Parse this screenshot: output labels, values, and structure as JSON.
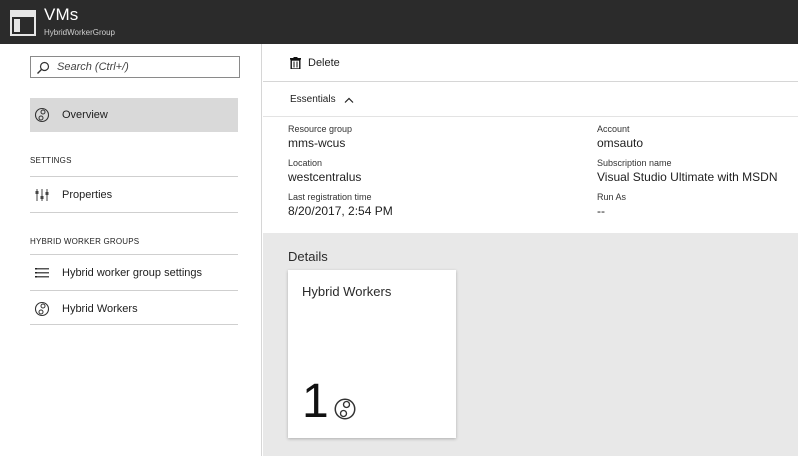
{
  "header": {
    "title": "VMs",
    "subtitle": "HybridWorkerGroup"
  },
  "sidebar": {
    "search_placeholder": "Search (Ctrl+/)",
    "overview_label": "Overview",
    "settings_section": "SETTINGS",
    "properties_label": "Properties",
    "hybrid_section": "HYBRID WORKER GROUPS",
    "hwg_settings_label": "Hybrid worker group settings",
    "hybrid_workers_label": "Hybrid Workers"
  },
  "toolbar": {
    "delete_label": "Delete"
  },
  "essentials": {
    "header": "Essentials",
    "resource_group_label": "Resource group",
    "resource_group_value": "mms-wcus",
    "location_label": "Location",
    "location_value": "westcentralus",
    "last_reg_label": "Last registration time",
    "last_reg_value": "8/20/2017, 2:54 PM",
    "account_label": "Account",
    "account_value": "omsauto",
    "subscription_label": "Subscription name",
    "subscription_value": "Visual Studio Ultimate with MSDN",
    "runas_label": "Run As",
    "runas_value": "--"
  },
  "details": {
    "title": "Details",
    "tile_title": "Hybrid Workers",
    "tile_count": "1"
  },
  "icons": {
    "title": "blade-icon",
    "search": "search-icon",
    "overview": "hybrid-worker-icon",
    "properties": "properties-icon",
    "hwg_settings": "settings-list-icon",
    "hybrid_workers": "hybrid-worker-icon",
    "delete": "trash-icon",
    "essentials": "chevron-up-icon"
  },
  "colors": {
    "titlebar": "#2b2b2b",
    "selected_nav": "#d9d9d9",
    "details_bg": "#e8e8e8"
  }
}
